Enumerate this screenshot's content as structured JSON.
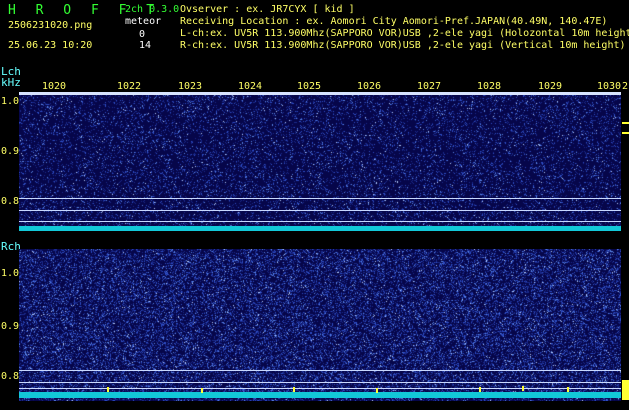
{
  "header": {
    "logo": "H R O F F T",
    "mode": "2ch 0.3.0",
    "file_name": "2506231020.png",
    "meteor_label": "meteor",
    "meteor_l": "0",
    "meteor_r": "14",
    "datetime": "25.06.23 10:20",
    "observer": "Ovserver                : ex. JR7CYX [ kid ]",
    "location": "Receiving Location : ex. Aomori City Aomori-Pref.JAPAN(40.49N, 140.47E)",
    "lch_info": "L-ch:ex. UV5R 113.900Mhz(SAPPORO VOR)USB ,2-ele yagi (Holozontal 10m height)",
    "rch_info": "R-ch:ex. UV5R 113.900Mhz(SAPPORO VOR)USB ,2-ele yagi (Vertical 10m height)"
  },
  "lch": {
    "label": "Lch",
    "unit": "kHz",
    "y_ticks": [
      "1.0",
      "0.9",
      "0.8"
    ]
  },
  "rch": {
    "label": "Rch",
    "y_ticks": [
      "1.0",
      "0.9",
      "0.8"
    ]
  },
  "time_ticks": [
    "1020",
    "1022",
    "1023",
    "1024",
    "1025",
    "1026",
    "1027",
    "1028",
    "1029",
    "1030",
    "2"
  ],
  "colors": {
    "background": "#000000",
    "panel": "#06064a",
    "floor": "#12c8d8",
    "text_yellow": "#ffff66",
    "text_green": "#33ff33"
  }
}
